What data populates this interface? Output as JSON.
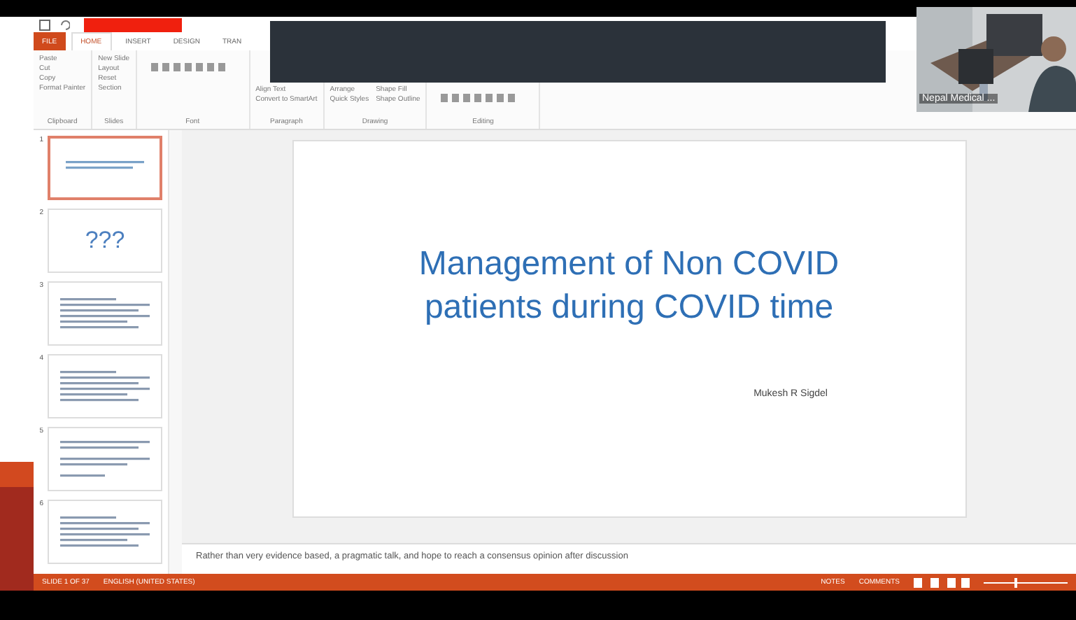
{
  "tabs": [
    {
      "label": "FILE",
      "selected": false,
      "kind": "file"
    },
    {
      "label": "HOME",
      "selected": true,
      "kind": "tab"
    },
    {
      "label": "INSERT",
      "selected": false,
      "kind": "tab"
    },
    {
      "label": "DESIGN",
      "selected": false,
      "kind": "tab"
    },
    {
      "label": "TRAN",
      "selected": false,
      "kind": "tab"
    }
  ],
  "ribbon": {
    "groups": [
      {
        "label": "Clipboard",
        "items": [
          "Paste",
          "Cut",
          "Copy",
          "Format Painter"
        ]
      },
      {
        "label": "Slides",
        "items": [
          "New Slide",
          "Layout",
          "Reset",
          "Section"
        ]
      },
      {
        "label": "Font"
      },
      {
        "label": "Paragraph",
        "items": [
          "Align Text",
          "Convert to SmartArt"
        ]
      },
      {
        "label": "Drawing",
        "items": [
          "Arrange",
          "Quick Styles",
          "Shape Fill",
          "Shape Outline"
        ]
      },
      {
        "label": "Editing"
      }
    ]
  },
  "video": {
    "name": "Nepal Medical ..."
  },
  "thumbnails": [
    {
      "number": "1",
      "selected": true,
      "kind": "title"
    },
    {
      "number": "2",
      "selected": false,
      "kind": "marks",
      "text": "???"
    },
    {
      "number": "3",
      "selected": false,
      "kind": "list"
    },
    {
      "number": "4",
      "selected": false,
      "kind": "list"
    },
    {
      "number": "5",
      "selected": false,
      "kind": "text"
    },
    {
      "number": "6",
      "selected": false,
      "kind": "list"
    }
  ],
  "slide": {
    "title": "Management of Non COVID patients during COVID time",
    "author": "Mukesh R Sigdel"
  },
  "notes": "Rather than very evidence based, a pragmatic talk, and hope to reach a consensus opinion after discussion",
  "status_bar": {
    "slide": "SLIDE 1 OF 37",
    "language": "ENGLISH (UNITED STATES)",
    "notes": "NOTES",
    "comments": "COMMENTS"
  }
}
